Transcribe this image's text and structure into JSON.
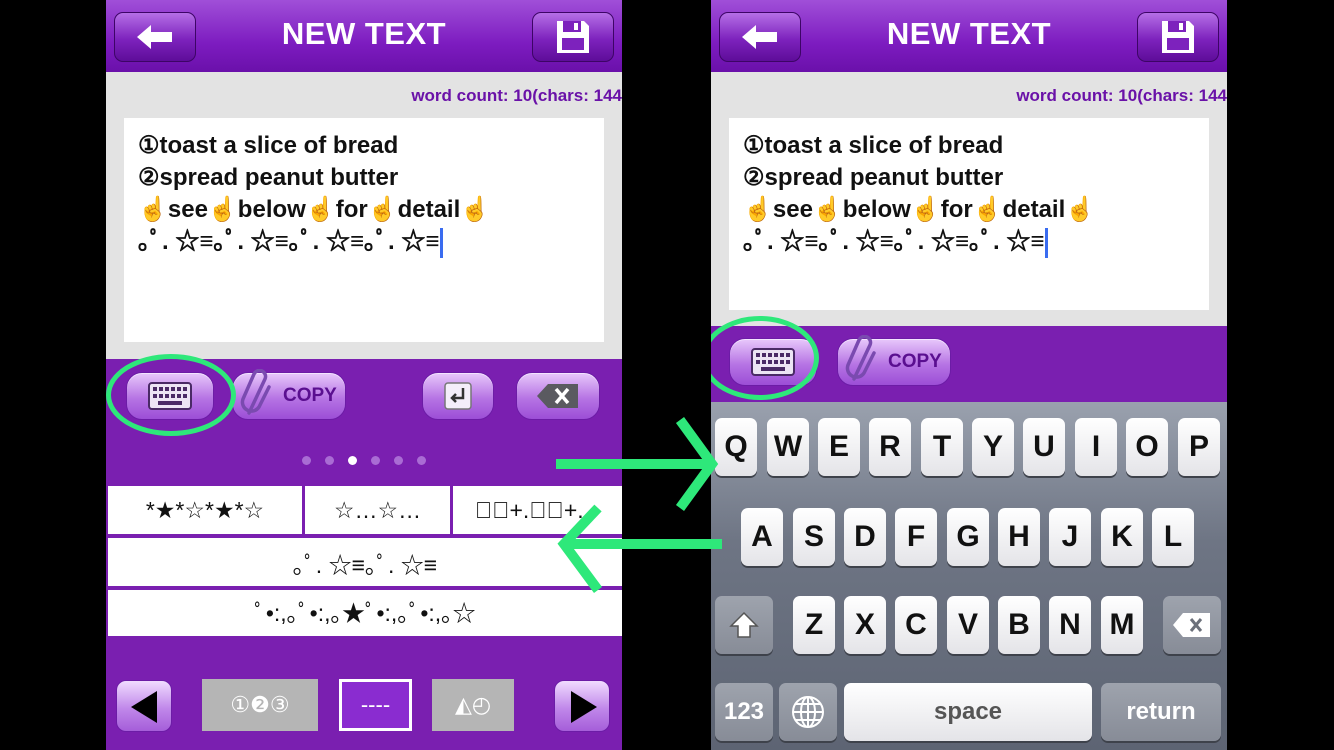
{
  "left_screen": {
    "title": "NEW TEXT",
    "word_count": "word count: 10(chars: 144",
    "text_lines": [
      "①toast a slice of bread",
      "②spread peanut butter",
      " ☝see☝below☝for☝detail☝",
      "｡ﾟ. ☆≡｡ﾟ. ☆≡｡ﾟ. ☆≡｡ﾟ. ☆≡"
    ],
    "copy_label": "COPY",
    "page_dots": 6,
    "active_dot": 2,
    "symbols": {
      "row1": [
        "*★*☆*★*☆",
        "☆…☆…",
        "☆ﾟ+.☆ﾟ+."
      ],
      "row2": "｡ﾟ. ☆≡｡ﾟ. ☆≡",
      "row3": "ﾟ•:,｡ﾟ•:,｡★ﾟ•:,｡ﾟ•:,｡☆"
    },
    "tabs": [
      "①❷③",
      "----",
      "◭◴"
    ],
    "selected_tab": 1
  },
  "right_screen": {
    "title": "NEW TEXT",
    "word_count": "word count: 10(chars: 144",
    "text_lines": [
      "①toast a slice of bread",
      "②spread peanut butter",
      " ☝see☝below☝for☝detail☝",
      "｡ﾟ. ☆≡｡ﾟ. ☆≡｡ﾟ. ☆≡｡ﾟ. ☆≡"
    ],
    "copy_label": "COPY",
    "keyboard": {
      "row1": [
        "Q",
        "W",
        "E",
        "R",
        "T",
        "Y",
        "U",
        "I",
        "O",
        "P"
      ],
      "row2": [
        "A",
        "S",
        "D",
        "F",
        "G",
        "H",
        "J",
        "K",
        "L"
      ],
      "row3": [
        "Z",
        "X",
        "C",
        "V",
        "B",
        "N",
        "M"
      ],
      "numbers_key": "123",
      "space_key": "space",
      "return_key": "return"
    }
  },
  "icons": {
    "back": "back-arrow-icon",
    "save": "floppy-disk-icon",
    "keyboard": "keyboard-icon",
    "clip": "paperclip-icon",
    "enter": "return-icon",
    "delete": "backspace-icon",
    "prev": "triangle-left-icon",
    "next": "triangle-right-icon",
    "shift": "shift-icon",
    "globe": "globe-icon"
  },
  "colors": {
    "brand_purple": "#7a1fb0",
    "highlight_green": "#2ee87a",
    "caret_blue": "#3a6cf0"
  }
}
